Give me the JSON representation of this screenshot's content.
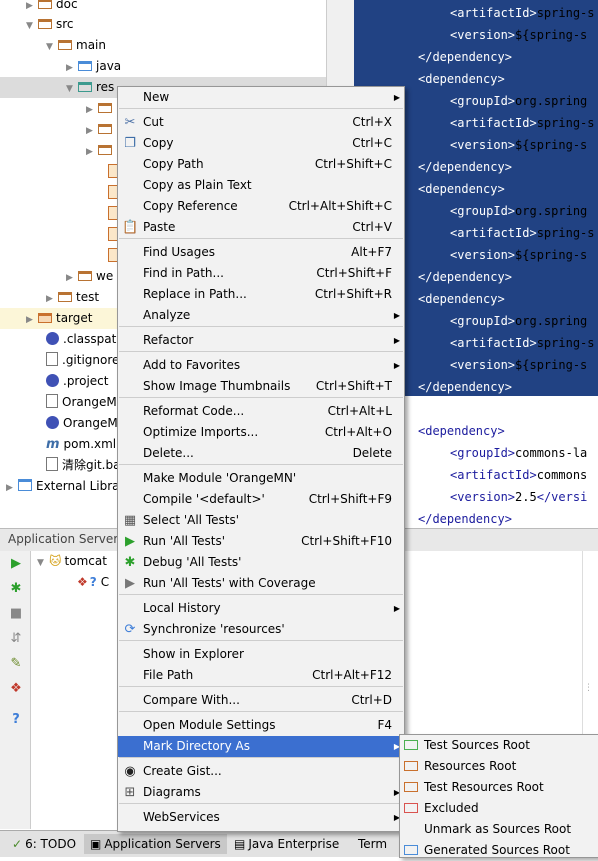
{
  "tree": {
    "items": [
      "doc",
      "src",
      "main",
      "java",
      "res",
      "test",
      "target",
      ".classpath",
      ".gitignore",
      ".project",
      "OrangeM",
      "OrangeM",
      "pom.xml",
      "清除git.ba",
      "External Libra"
    ],
    "partial_we": "we"
  },
  "editor": {
    "lines": [
      {
        "indent": "    ",
        "parts": [
          {
            "t": "tag",
            "v": "<artifactId>"
          },
          {
            "t": "txt",
            "v": "spring-s"
          }
        ],
        "sel": true
      },
      {
        "indent": "    ",
        "parts": [
          {
            "t": "tag",
            "v": "<version>"
          },
          {
            "t": "txt",
            "v": "${spring-s"
          }
        ],
        "sel": true
      },
      {
        "indent": "",
        "parts": [
          {
            "t": "tag",
            "v": "</dependency>"
          }
        ],
        "sel": true
      },
      {
        "indent": "",
        "parts": [
          {
            "t": "tag",
            "v": "<dependency>"
          }
        ],
        "sel": true
      },
      {
        "indent": "    ",
        "parts": [
          {
            "t": "tag",
            "v": "<groupId>"
          },
          {
            "t": "txt",
            "v": "org.spring"
          }
        ],
        "sel": true
      },
      {
        "indent": "    ",
        "parts": [
          {
            "t": "tag",
            "v": "<artifactId>"
          },
          {
            "t": "txt",
            "v": "spring-s"
          }
        ],
        "sel": true
      },
      {
        "indent": "    ",
        "parts": [
          {
            "t": "tag",
            "v": "<version>"
          },
          {
            "t": "txt",
            "v": "${spring-s"
          }
        ],
        "sel": true
      },
      {
        "indent": "",
        "parts": [
          {
            "t": "tag",
            "v": "</dependency>"
          }
        ],
        "sel": true
      },
      {
        "indent": "",
        "parts": [
          {
            "t": "tag",
            "v": "<dependency>"
          }
        ],
        "sel": true
      },
      {
        "indent": "    ",
        "parts": [
          {
            "t": "tag",
            "v": "<groupId>"
          },
          {
            "t": "txt",
            "v": "org.spring"
          }
        ],
        "sel": true
      },
      {
        "indent": "    ",
        "parts": [
          {
            "t": "tag",
            "v": "<artifactId>"
          },
          {
            "t": "txt",
            "v": "spring-s"
          }
        ],
        "sel": true
      },
      {
        "indent": "    ",
        "parts": [
          {
            "t": "tag",
            "v": "<version>"
          },
          {
            "t": "txt",
            "v": "${spring-s"
          }
        ],
        "sel": true
      },
      {
        "indent": "",
        "parts": [
          {
            "t": "tag",
            "v": "</dependency>"
          }
        ],
        "sel": true
      },
      {
        "indent": "",
        "parts": [
          {
            "t": "tag",
            "v": "<dependency>"
          }
        ],
        "sel": true
      },
      {
        "indent": "    ",
        "parts": [
          {
            "t": "tag",
            "v": "<groupId>"
          },
          {
            "t": "txt",
            "v": "org.spring"
          }
        ],
        "sel": true
      },
      {
        "indent": "    ",
        "parts": [
          {
            "t": "tag",
            "v": "<artifactId>"
          },
          {
            "t": "txt",
            "v": "spring-s"
          }
        ],
        "sel": true
      },
      {
        "indent": "    ",
        "parts": [
          {
            "t": "tag",
            "v": "<version>"
          },
          {
            "t": "txt",
            "v": "${spring-s"
          }
        ],
        "sel": true
      },
      {
        "indent": "",
        "parts": [
          {
            "t": "tag",
            "v": "</dependency>"
          }
        ],
        "sel": true
      },
      {
        "indent": "",
        "parts": [],
        "sel": false
      },
      {
        "indent": "",
        "parts": [
          {
            "t": "tag",
            "v": "<dependency>"
          }
        ],
        "sel": false
      },
      {
        "indent": "    ",
        "parts": [
          {
            "t": "tag",
            "v": "<groupId>"
          },
          {
            "t": "txt",
            "v": "commons-la"
          }
        ],
        "sel": false
      },
      {
        "indent": "    ",
        "parts": [
          {
            "t": "tag",
            "v": "<artifactId>"
          },
          {
            "t": "txt",
            "v": "commons"
          }
        ],
        "sel": false
      },
      {
        "indent": "    ",
        "parts": [
          {
            "t": "tag",
            "v": "<version>"
          },
          {
            "t": "txt",
            "v": "2.5"
          },
          {
            "t": "tag",
            "v": "</versi"
          }
        ],
        "sel": false
      },
      {
        "indent": "",
        "parts": [
          {
            "t": "tag",
            "v": "</dependency>"
          }
        ],
        "sel": false
      }
    ]
  },
  "servers": {
    "title": "Application Servers",
    "node": "tomcat",
    "child": "C"
  },
  "bottom_tabs": {
    "todo": "6: TODO",
    "app_servers": "Application Servers",
    "java_ee": "Java Enterprise",
    "terminal": "Term"
  },
  "menu": {
    "items": [
      {
        "label": "New",
        "shortcut": "",
        "sub": true,
        "icon": ""
      },
      {
        "label": "Cut",
        "shortcut": "Ctrl+X",
        "sub": false,
        "icon": "scissors"
      },
      {
        "label": "Copy",
        "shortcut": "Ctrl+C",
        "sub": false,
        "icon": "copy"
      },
      {
        "label": "Copy Path",
        "shortcut": "Ctrl+Shift+C",
        "sub": false,
        "icon": ""
      },
      {
        "label": "Copy as Plain Text",
        "shortcut": "",
        "sub": false,
        "icon": ""
      },
      {
        "label": "Copy Reference",
        "shortcut": "Ctrl+Alt+Shift+C",
        "sub": false,
        "icon": ""
      },
      {
        "label": "Paste",
        "shortcut": "Ctrl+V",
        "sub": false,
        "icon": "paste"
      },
      {
        "label": "Find Usages",
        "shortcut": "Alt+F7",
        "sub": false,
        "icon": ""
      },
      {
        "label": "Find in Path...",
        "shortcut": "Ctrl+Shift+F",
        "sub": false,
        "icon": ""
      },
      {
        "label": "Replace in Path...",
        "shortcut": "Ctrl+Shift+R",
        "sub": false,
        "icon": ""
      },
      {
        "label": "Analyze",
        "shortcut": "",
        "sub": true,
        "icon": ""
      },
      {
        "label": "Refactor",
        "shortcut": "",
        "sub": true,
        "icon": ""
      },
      {
        "label": "Add to Favorites",
        "shortcut": "",
        "sub": true,
        "icon": ""
      },
      {
        "label": "Show Image Thumbnails",
        "shortcut": "Ctrl+Shift+T",
        "sub": false,
        "icon": ""
      },
      {
        "label": "Reformat Code...",
        "shortcut": "Ctrl+Alt+L",
        "sub": false,
        "icon": ""
      },
      {
        "label": "Optimize Imports...",
        "shortcut": "Ctrl+Alt+O",
        "sub": false,
        "icon": ""
      },
      {
        "label": "Delete...",
        "shortcut": "Delete",
        "sub": false,
        "icon": ""
      },
      {
        "label": "Make Module 'OrangeMN'",
        "shortcut": "",
        "sub": false,
        "icon": ""
      },
      {
        "label": "Compile '<default>'",
        "shortcut": "Ctrl+Shift+F9",
        "sub": false,
        "icon": ""
      },
      {
        "label": "Select 'All Tests'",
        "shortcut": "",
        "sub": false,
        "icon": "select"
      },
      {
        "label": "Run 'All Tests'",
        "shortcut": "Ctrl+Shift+F10",
        "sub": false,
        "icon": "run"
      },
      {
        "label": "Debug 'All Tests'",
        "shortcut": "",
        "sub": false,
        "icon": "debug"
      },
      {
        "label": "Run 'All Tests' with Coverage",
        "shortcut": "",
        "sub": false,
        "icon": "coverage"
      },
      {
        "label": "Local History",
        "shortcut": "",
        "sub": true,
        "icon": ""
      },
      {
        "label": "Synchronize 'resources'",
        "shortcut": "",
        "sub": false,
        "icon": "sync"
      },
      {
        "label": "Show in Explorer",
        "shortcut": "",
        "sub": false,
        "icon": ""
      },
      {
        "label": "File Path",
        "shortcut": "Ctrl+Alt+F12",
        "sub": false,
        "icon": ""
      },
      {
        "label": "Compare With...",
        "shortcut": "Ctrl+D",
        "sub": false,
        "icon": ""
      },
      {
        "label": "Open Module Settings",
        "shortcut": "F4",
        "sub": false,
        "icon": ""
      },
      {
        "label": "Mark Directory As",
        "shortcut": "",
        "sub": true,
        "icon": ""
      },
      {
        "label": "Create Gist...",
        "shortcut": "",
        "sub": false,
        "icon": "github"
      },
      {
        "label": "Diagrams",
        "shortcut": "",
        "sub": true,
        "icon": "diagram"
      },
      {
        "label": "WebServices",
        "shortcut": "",
        "sub": true,
        "icon": ""
      }
    ]
  },
  "submenu": {
    "items": [
      {
        "label": "Test Sources Root",
        "color": "#4caf50"
      },
      {
        "label": "Resources Root",
        "color": "#c9702d"
      },
      {
        "label": "Test Resources Root",
        "color": "#c9702d"
      },
      {
        "label": "Excluded",
        "color": "#d9534f"
      },
      {
        "label": "Unmark as Sources Root",
        "color": ""
      },
      {
        "label": "Generated Sources Root",
        "color": "#4a8cd8"
      }
    ]
  }
}
